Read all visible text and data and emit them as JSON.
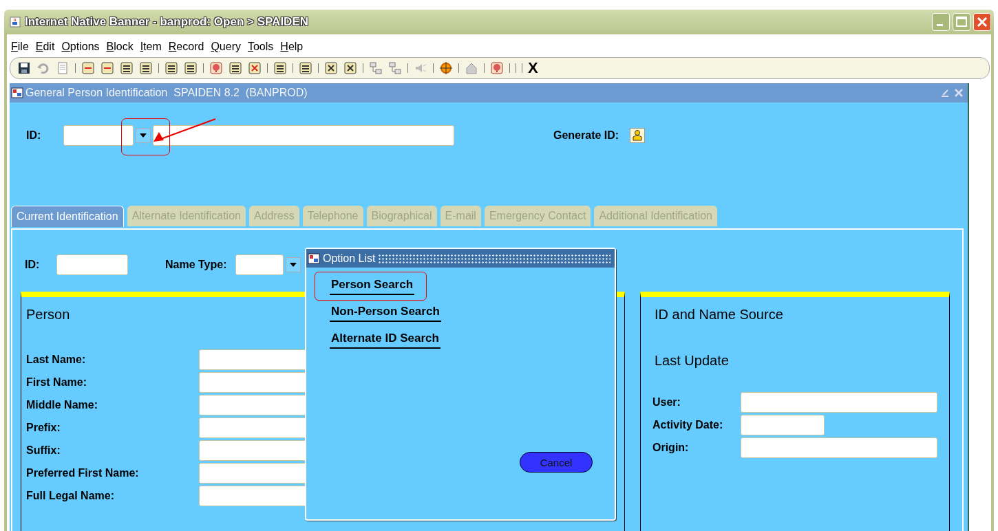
{
  "window": {
    "title": "Internet Native Banner - banprod:  Open > SPAIDEN"
  },
  "menu": [
    {
      "label": "File"
    },
    {
      "label": "Edit"
    },
    {
      "label": "Options"
    },
    {
      "label": "Block"
    },
    {
      "label": "Item"
    },
    {
      "label": "Record"
    },
    {
      "label": "Query"
    },
    {
      "label": "Tools"
    },
    {
      "label": "Help"
    }
  ],
  "toolbar": {
    "exit_label": "X"
  },
  "form": {
    "title": "General Person Identification  SPAIDEN 8.2  (BANPROD)",
    "key_block": {
      "id_label": "ID:",
      "generate_label": "Generate ID:"
    },
    "tabs": [
      {
        "label": "Current Identification",
        "selected": true,
        "disabled": false
      },
      {
        "label": "Alternate Identification",
        "selected": false,
        "disabled": true
      },
      {
        "label": "Address",
        "selected": false,
        "disabled": true
      },
      {
        "label": "Telephone",
        "selected": false,
        "disabled": true
      },
      {
        "label": "Biographical",
        "selected": false,
        "disabled": true
      },
      {
        "label": "E-mail",
        "selected": false,
        "disabled": true
      },
      {
        "label": "Emergency Contact",
        "selected": false,
        "disabled": true
      },
      {
        "label": "Additional Identification",
        "selected": false,
        "disabled": true
      }
    ],
    "id_row": {
      "id_label": "ID:",
      "name_type_label": "Name Type:"
    },
    "person": {
      "title": "Person",
      "fields": [
        "Last Name:",
        "First Name:",
        "Middle Name:",
        "Prefix:",
        "Suffix:",
        "Preferred First Name:",
        "Full Legal Name:"
      ]
    },
    "source": {
      "title": "ID and Name Source",
      "subtitle": "Last Update",
      "fields": [
        {
          "label": "User:",
          "kind": "text"
        },
        {
          "label": "Activity Date:",
          "kind": "date"
        },
        {
          "label": "Origin:",
          "kind": "text"
        }
      ]
    }
  },
  "option_list": {
    "title": "Option List",
    "items": [
      {
        "label": "Person Search",
        "selected": true
      },
      {
        "label": "Non-Person Search",
        "selected": false
      },
      {
        "label": "Alternate ID Search",
        "selected": false
      }
    ],
    "cancel": "Cancel"
  }
}
